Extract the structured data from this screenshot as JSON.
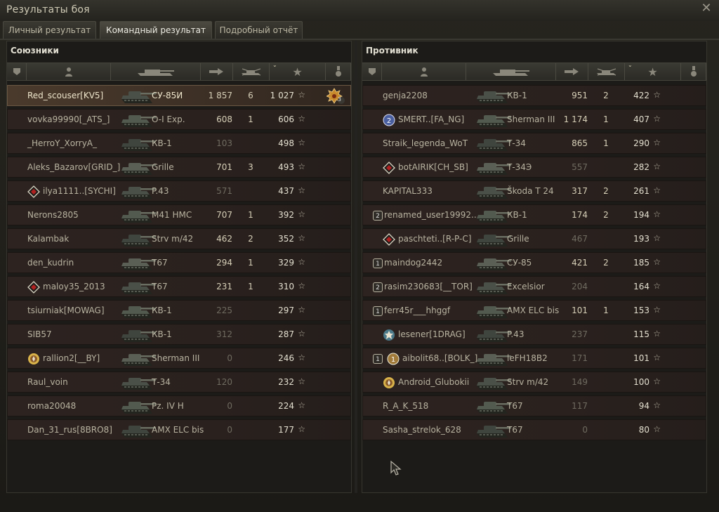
{
  "window": {
    "title": "Результаты боя",
    "close_glyph": "✕"
  },
  "tabs": [
    {
      "label": "Личный результат",
      "active": false
    },
    {
      "label": "Командный результат",
      "active": true
    },
    {
      "label": "Подробный отчёт",
      "active": false
    }
  ],
  "allies": {
    "title": "Союзники",
    "rows": [
      {
        "player": "Red_scouser[KV5]",
        "vehicle": "СУ-85И",
        "damage": "1 857",
        "kills": "6",
        "xp": "1 027",
        "highlight": true,
        "order_badge": "3"
      },
      {
        "player": "vovka99990[_ATS_]",
        "vehicle": "O-I Exp.",
        "damage": "608",
        "kills": "1",
        "xp": "606"
      },
      {
        "player": "_HerroY_XorryA_",
        "vehicle": "КВ-1",
        "damage": "103",
        "kills": "",
        "xp": "498"
      },
      {
        "player": "Aleks_Bazarov[GRID_]",
        "vehicle": "Grille",
        "damage": "701",
        "kills": "3",
        "xp": "493",
        "hot": true
      },
      {
        "player": "ilya1111..[SYCHI]",
        "vehicle": "P.43",
        "damage": "571",
        "kills": "",
        "xp": "437",
        "icon": "diamond-medal"
      },
      {
        "player": "Nerons2805",
        "vehicle": "M41 HMC",
        "damage": "707",
        "kills": "1",
        "xp": "392",
        "hot": true
      },
      {
        "player": "Kalambak",
        "vehicle": "Strv m/42",
        "damage": "462",
        "kills": "2",
        "xp": "352",
        "hot": true
      },
      {
        "player": "den_kudrin",
        "vehicle": "T67",
        "damage": "294",
        "kills": "1",
        "xp": "329"
      },
      {
        "player": "maloy35_2013",
        "vehicle": "T67",
        "damage": "231",
        "kills": "1",
        "xp": "310",
        "icon": "diamond-medal"
      },
      {
        "player": "tsiurniak[MOWAG]",
        "vehicle": "КВ-1",
        "damage": "225",
        "kills": "",
        "xp": "297"
      },
      {
        "player": "SIB57",
        "vehicle": "КВ-1",
        "damage": "312",
        "kills": "",
        "xp": "287"
      },
      {
        "player": "rallion2[__BY]",
        "vehicle": "Sherman III",
        "damage": "0",
        "kills": "",
        "xp": "246",
        "icon": "sun-medal"
      },
      {
        "player": "Raul_voin",
        "vehicle": "Т-34",
        "damage": "120",
        "kills": "",
        "xp": "232"
      },
      {
        "player": "roma20048",
        "vehicle": "Pz. IV H",
        "damage": "0",
        "kills": "",
        "xp": "224"
      },
      {
        "player": "Dan_31_rus[8BRO8]",
        "vehicle": "AMX ELC bis",
        "damage": "0",
        "kills": "",
        "xp": "177"
      }
    ]
  },
  "enemies": {
    "title": "Противник",
    "rows": [
      {
        "player": "genja2208",
        "vehicle": "КВ-1",
        "damage": "951",
        "kills": "2",
        "xp": "422"
      },
      {
        "player": "SMERT..[FA_NG]",
        "vehicle": "Sherman III",
        "damage": "1 174",
        "kills": "1",
        "xp": "407",
        "icon": "round-2-medal"
      },
      {
        "player": "Straik_legenda_WoT",
        "vehicle": "Т-34",
        "damage": "865",
        "kills": "1",
        "xp": "290"
      },
      {
        "player": "botAIRIK[CH_SB]",
        "vehicle": "Т-34Э",
        "damage": "557",
        "kills": "",
        "xp": "282",
        "icon": "diamond-medal"
      },
      {
        "player": "KAPITAL333",
        "vehicle": "Škoda T 24",
        "damage": "317",
        "kills": "2",
        "xp": "261"
      },
      {
        "player": "renamed_user19992..",
        "vehicle": "КВ-1",
        "damage": "174",
        "kills": "2",
        "xp": "194",
        "squad": "2"
      },
      {
        "player": "paschteti..[R-P-C]",
        "vehicle": "Grille",
        "damage": "467",
        "kills": "",
        "xp": "193",
        "icon": "diamond-medal"
      },
      {
        "player": "maindog2442",
        "vehicle": "СУ-85",
        "damage": "421",
        "kills": "2",
        "xp": "185",
        "squad": "1"
      },
      {
        "player": "rasim230683[__TOR]",
        "vehicle": "Excelsior",
        "damage": "204",
        "kills": "",
        "xp": "164",
        "squad": "2"
      },
      {
        "player": "ferr45r___hhggf",
        "vehicle": "AMX ELC bis",
        "damage": "101",
        "kills": "1",
        "xp": "153",
        "squad": "1"
      },
      {
        "player": "lesener[1DRAG]",
        "vehicle": "P.43",
        "damage": "237",
        "kills": "",
        "xp": "115",
        "icon": "star-medal"
      },
      {
        "player": "aibolit68..[BOLK_]",
        "vehicle": "leFH18B2",
        "damage": "171",
        "kills": "",
        "xp": "101",
        "squad": "1",
        "icon": "round-1-medal"
      },
      {
        "player": "Android_Glubokii",
        "vehicle": "Strv m/42",
        "damage": "149",
        "kills": "",
        "xp": "100",
        "icon": "sun-medal"
      },
      {
        "player": "R_A_K_518",
        "vehicle": "T67",
        "damage": "117",
        "kills": "",
        "xp": "94"
      },
      {
        "player": "Sasha_strelok_628",
        "vehicle": "T67",
        "damage": "0",
        "kills": "",
        "xp": "80"
      }
    ]
  },
  "icons": {
    "header": [
      "squad-icon",
      "player-icon",
      "tank-icon",
      "damage-icon",
      "kills-icon",
      "xp-star-icon",
      "medal-icon"
    ],
    "star_glyph": "☆"
  },
  "colors": {
    "highlight_row": "#4a3a2c",
    "row": "#2d2320",
    "accent": "#d6cfb7"
  }
}
